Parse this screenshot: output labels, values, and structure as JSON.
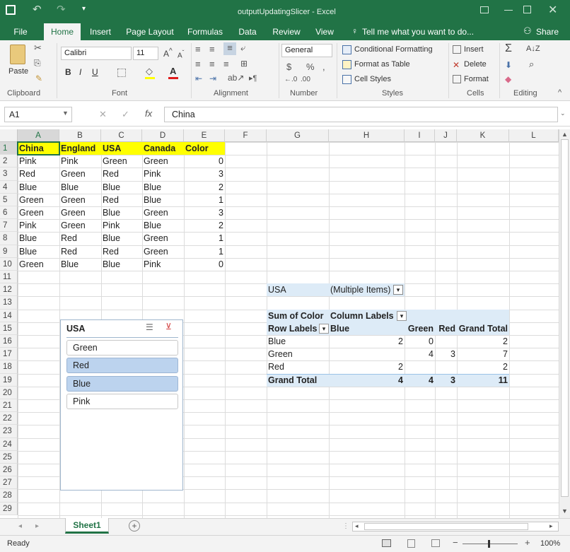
{
  "title": {
    "filename": "outputUpdatingSlicer - Excel"
  },
  "tabs": [
    "File",
    "Home",
    "Insert",
    "Page Layout",
    "Formulas",
    "Data",
    "Review",
    "View"
  ],
  "tell_me": "Tell me what you want to do...",
  "share": "Share",
  "ribbon": {
    "paste": "Paste",
    "font_name": "Calibri",
    "font_size": "11",
    "number_format": "General",
    "conditional_formatting": "Conditional Formatting",
    "format_as_table": "Format as Table",
    "cell_styles": "Cell Styles",
    "insert": "Insert",
    "delete": "Delete",
    "format": "Format",
    "groups": [
      "Clipboard",
      "Font",
      "Alignment",
      "Number",
      "Styles",
      "Cells",
      "Editing"
    ]
  },
  "formula_bar": {
    "name_box": "A1",
    "formula": "China"
  },
  "columns": [
    "A",
    "B",
    "C",
    "D",
    "E",
    "F",
    "G",
    "H",
    "I",
    "J",
    "K",
    "L"
  ],
  "rows": [
    "1",
    "2",
    "3",
    "4",
    "5",
    "6",
    "7",
    "8",
    "9",
    "10",
    "11",
    "12",
    "13",
    "14",
    "15",
    "16",
    "17",
    "18",
    "19",
    "20",
    "21",
    "22",
    "23",
    "24",
    "25",
    "26",
    "27",
    "28",
    "29"
  ],
  "table": {
    "headers": [
      "China",
      "England",
      "USA",
      "Canada",
      "Color"
    ],
    "rows": [
      [
        "Pink",
        "Pink",
        "Green",
        "Green",
        "0"
      ],
      [
        "Red",
        "Green",
        "Red",
        "Pink",
        "3"
      ],
      [
        "Blue",
        "Blue",
        "Blue",
        "Blue",
        "2"
      ],
      [
        "Green",
        "Green",
        "Red",
        "Blue",
        "1"
      ],
      [
        "Green",
        "Green",
        "Blue",
        "Green",
        "3"
      ],
      [
        "Pink",
        "Green",
        "Pink",
        "Blue",
        "2"
      ],
      [
        "Blue",
        "Red",
        "Blue",
        "Green",
        "1"
      ],
      [
        "Blue",
        "Red",
        "Red",
        "Green",
        "1"
      ],
      [
        "Green",
        "Blue",
        "Blue",
        "Pink",
        "0"
      ]
    ],
    "header_fill": "#ffff00"
  },
  "pivot": {
    "filter_field": "USA",
    "filter_value": "(Multiple Items)",
    "value_label": "Sum of Color",
    "column_labels": "Column Labels",
    "row_labels": "Row Labels",
    "col_headers": [
      "Blue",
      "Green",
      "Red",
      "Grand Total"
    ],
    "rows": [
      {
        "label": "Blue",
        "values": [
          "2",
          "0",
          "",
          "2"
        ]
      },
      {
        "label": "Green",
        "values": [
          "",
          "4",
          "3",
          "7"
        ]
      },
      {
        "label": "Red",
        "values": [
          "2",
          "",
          "",
          "2"
        ]
      }
    ],
    "grand_total": {
      "label": "Grand Total",
      "values": [
        "4",
        "4",
        "3",
        "11"
      ]
    },
    "header_fill": "#ddebf7"
  },
  "slicer": {
    "title": "USA",
    "items": [
      {
        "label": "Green",
        "selected": false
      },
      {
        "label": "Red",
        "selected": true
      },
      {
        "label": "Blue",
        "selected": true
      },
      {
        "label": "Pink",
        "selected": false
      }
    ]
  },
  "sheet_tab": "Sheet1",
  "status": {
    "ready": "Ready",
    "zoom": "100%"
  }
}
